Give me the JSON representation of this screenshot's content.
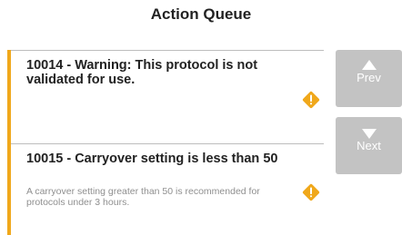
{
  "header": {
    "title": "Action Queue"
  },
  "queue": {
    "items": [
      {
        "heading": "10014 - Warning: This protocol is not validated for use.",
        "description": "",
        "icon": "warning-diamond-icon"
      },
      {
        "heading": "10015 - Carryover setting is less than 50",
        "description": "A carryover setting greater than 50 is recommended for protocols under 3 hours.",
        "icon": "warning-diamond-icon"
      }
    ]
  },
  "nav": {
    "prev_label": "Prev",
    "next_label": "Next"
  },
  "colors": {
    "accent": "#f0a81b",
    "button": "#c3c3c3",
    "divider": "#bdbdbd"
  }
}
